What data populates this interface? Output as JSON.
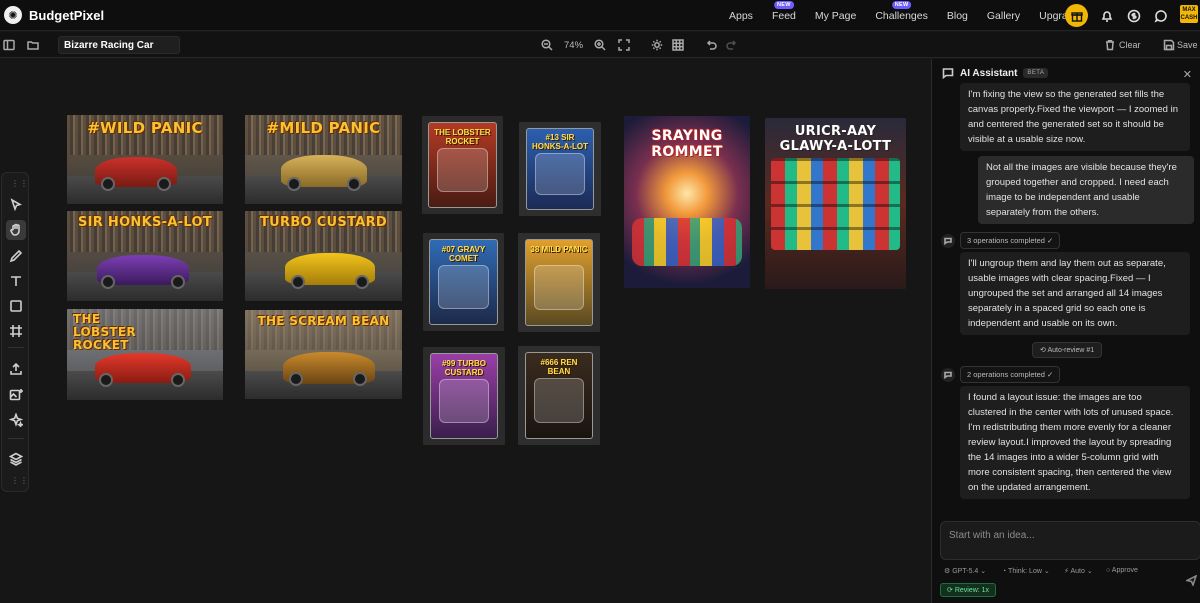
{
  "brand": {
    "name": "BudgetPixel",
    "logo_icon": "budgetpixel-logo"
  },
  "nav": {
    "links": [
      {
        "label": "Apps",
        "badge": ""
      },
      {
        "label": "Feed",
        "badge": "NEW"
      },
      {
        "label": "My Page",
        "badge": ""
      },
      {
        "label": "Challenges",
        "badge": "NEW"
      },
      {
        "label": "Blog",
        "badge": ""
      },
      {
        "label": "Gallery",
        "badge": ""
      },
      {
        "label": "Upgrade",
        "badge": ""
      }
    ],
    "max_cash": "MAX\nCASH",
    "accent_color": "#f2b705"
  },
  "toolbar": {
    "project_title": "Bizarre Racing Car",
    "zoom": "74%",
    "clear_label": "Clear",
    "save_label": "Save"
  },
  "canvas": {
    "images": [
      {
        "caption": "#WILD PANIC",
        "kind": "race"
      },
      {
        "caption": "#MILD PANIC",
        "kind": "race"
      },
      {
        "caption": "THE LOBSTER ROCKET",
        "kind": "package"
      },
      {
        "caption": "#13 SIR HONKS-A-LOT",
        "kind": "package"
      },
      {
        "caption": "SRAYING ROMMET",
        "kind": "poster"
      },
      {
        "caption": "URICR-AAY GLAWY-A-LOTT",
        "kind": "poster"
      },
      {
        "caption": "SIR HONKS-A-LOT",
        "kind": "race"
      },
      {
        "caption": "TURBO CUSTARD",
        "kind": "race"
      },
      {
        "caption": "#07 GRAVY COMET",
        "kind": "package"
      },
      {
        "caption": "38 MILD PANIC",
        "kind": "package"
      },
      {
        "caption": "THE LOBSTER ROCKET",
        "kind": "race"
      },
      {
        "caption": "THE SCREAM BEAN",
        "kind": "race"
      },
      {
        "caption": "#99 TURBO CUSTARD",
        "kind": "package"
      },
      {
        "caption": "#666 REN BEAN",
        "kind": "package"
      }
    ]
  },
  "assistant": {
    "title": "AI Assistant",
    "beta": "BETA",
    "messages": [
      {
        "role": "ai",
        "text": "I'm fixing the view so the generated set fills the canvas properly.Fixed the viewport — I zoomed in and centered the generated set so it should be visible at a usable size now."
      },
      {
        "role": "user",
        "text": "Not all the images are visible because they're grouped together and cropped. I need each image to be independent and usable separately from the others."
      },
      {
        "role": "ops",
        "text": "3 operations completed ✓"
      },
      {
        "role": "ai",
        "text": "I'll ungroup them and lay them out as separate, usable images with clear spacing.Fixed — I ungrouped the set and arranged all 14 images separately in a spaced grid so each one is independent and usable on its own."
      },
      {
        "role": "chip",
        "text": "Auto-review #1"
      },
      {
        "role": "ops",
        "text": "2 operations completed ✓"
      },
      {
        "role": "ai",
        "text": "I found a layout issue: the images are too clustered in the center with lots of unused space. I'm redistributing them more evenly for a cleaner review layout.I improved the layout by spreading the 14 images into a wider 5-column grid with more consistent spacing, then centered the view on the updated arrangement."
      }
    ],
    "composer_placeholder": "Start with an idea...",
    "options": {
      "model": "GPT-5.4",
      "think": "Think: Low",
      "auto": "Auto",
      "approve": "Approve"
    },
    "review": "Review: 1x"
  }
}
